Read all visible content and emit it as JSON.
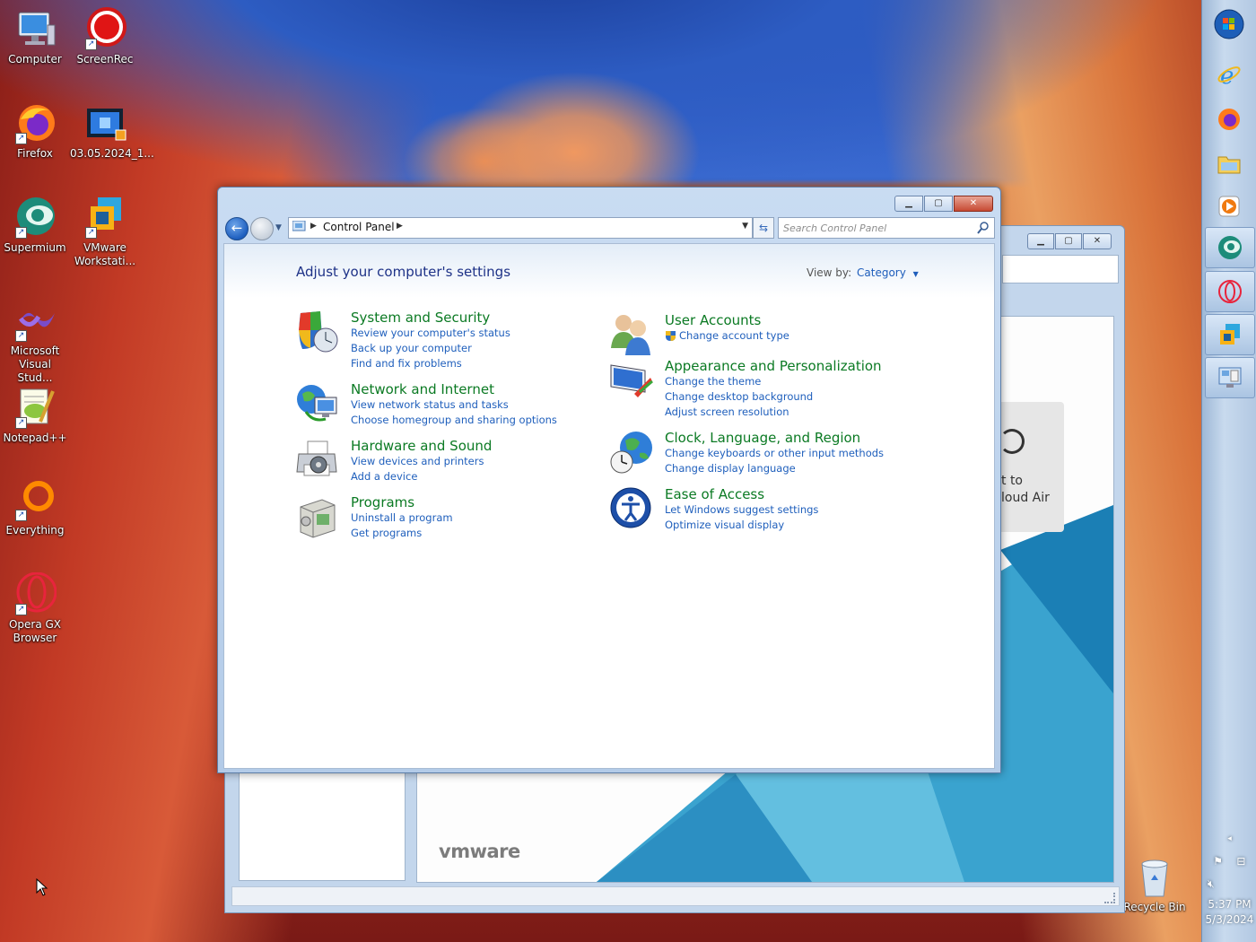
{
  "desktop": {
    "icons": [
      {
        "label": "Computer"
      },
      {
        "label": "ScreenRec"
      },
      {
        "label": "Firefox"
      },
      {
        "label": "03.05.2024_1..."
      },
      {
        "label": "Supermium"
      },
      {
        "label": "VMware Workstati..."
      },
      {
        "label": "Microsoft Visual Stud..."
      },
      {
        "label": "Notepad++"
      },
      {
        "label": "Everything"
      },
      {
        "label": "Opera GX Browser"
      }
    ],
    "recycle_bin": "Recycle Bin"
  },
  "taskbar": {
    "apps": [
      "start-orb",
      "internet-explorer",
      "firefox",
      "file-explorer",
      "media-player",
      "supermium",
      "opera-gx",
      "vmware-workstation",
      "control-panel"
    ],
    "clock_time": "5:37 PM",
    "clock_date": "5/3/2024"
  },
  "background_window": {
    "card_line1": "t to",
    "card_line2": "loud Air",
    "brand": "vmware"
  },
  "control_panel": {
    "breadcrumb": "Control Panel",
    "search_placeholder": "Search Control Panel",
    "heading": "Adjust your computer's settings",
    "view_by_label": "View by:",
    "view_by_value": "Category",
    "left": [
      {
        "title": "System and Security",
        "icon": "shield-icon",
        "links": [
          "Review your computer's status",
          "Back up your computer",
          "Find and fix problems"
        ]
      },
      {
        "title": "Network and Internet",
        "icon": "network-globe-icon",
        "links": [
          "View network status and tasks",
          "Choose homegroup and sharing options"
        ]
      },
      {
        "title": "Hardware and Sound",
        "icon": "printer-icon",
        "links": [
          "View devices and printers",
          "Add a device"
        ]
      },
      {
        "title": "Programs",
        "icon": "programs-box-icon",
        "links": [
          "Uninstall a program",
          "Get programs"
        ]
      }
    ],
    "right": [
      {
        "title": "User Accounts",
        "icon": "users-icon",
        "links": [
          "Change account type"
        ]
      },
      {
        "title": "Appearance and Personalization",
        "icon": "monitor-brush-icon",
        "links": [
          "Change the theme",
          "Change desktop background",
          "Adjust screen resolution"
        ]
      },
      {
        "title": "Clock, Language, and Region",
        "icon": "clock-globe-icon",
        "links": [
          "Change keyboards or other input methods",
          "Change display language"
        ]
      },
      {
        "title": "Ease of Access",
        "icon": "ease-of-access-icon",
        "links": [
          "Let Windows suggest settings",
          "Optimize visual display"
        ]
      }
    ]
  }
}
